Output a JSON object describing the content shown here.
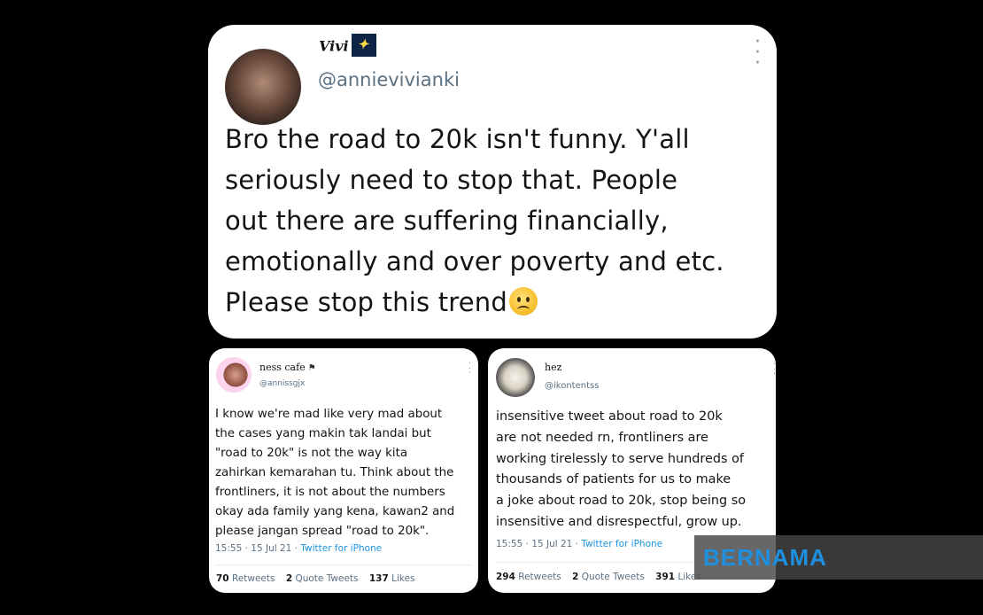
{
  "main_tweet": {
    "display_name": "Vivi",
    "handle": "@annievivianki",
    "text": "Bro the road to 20k isn't funny. Y'all\nseriously need to stop that. People\nout there are suffering financially,\nemotionally and over poverty and etc.\nPlease stop this trend",
    "emoji": "frowning-face"
  },
  "left_tweet": {
    "display_name": "ness cafe",
    "handle": "@annissgjx",
    "text": "I know we're mad like very mad about\nthe cases yang makin tak landai but\n\"road to 20k\" is not the way kita\nzahirkan kemarahan tu. Think about the\nfrontliners, it is not about the numbers\nokay ada family yang kena, kawan2 and\nplease jangan spread \"road to 20k\".",
    "time": "15:55 · 15 Jul 21 · ",
    "source": "Twitter for iPhone",
    "retweets": "70",
    "retweets_label": "Retweets",
    "quote_tweets": "2",
    "quote_tweets_label": "Quote Tweets",
    "likes": "137",
    "likes_label": "Likes"
  },
  "right_tweet": {
    "display_name": "hez",
    "handle": "@ikontentss",
    "text": "insensitive tweet about road to 20k\nare not needed rn, frontliners are\nworking tirelessly to serve hundreds of\nthousands of patients for us to make\na joke about road to 20k, stop being so\ninsensitive and disrespectful, grow up.",
    "time": "15:55 · 15 Jul 21 · ",
    "source": "Twitter for iPhone",
    "retweets": "294",
    "retweets_label": "Retweets",
    "quote_tweets": "2",
    "quote_tweets_label": "Quote Tweets",
    "likes": "391",
    "likes_label": "Likes"
  },
  "watermark": {
    "text": "BERNAMA",
    "color": "#1f8fe0"
  },
  "icons": {
    "more": "more-vertical-icon",
    "name_badge_main": "sparkle-icon",
    "name_badge_left": "flag-icon"
  },
  "colors": {
    "background": "#000000",
    "card": "#ffffff",
    "link": "#1b95e0",
    "muted": "#5b7083"
  }
}
